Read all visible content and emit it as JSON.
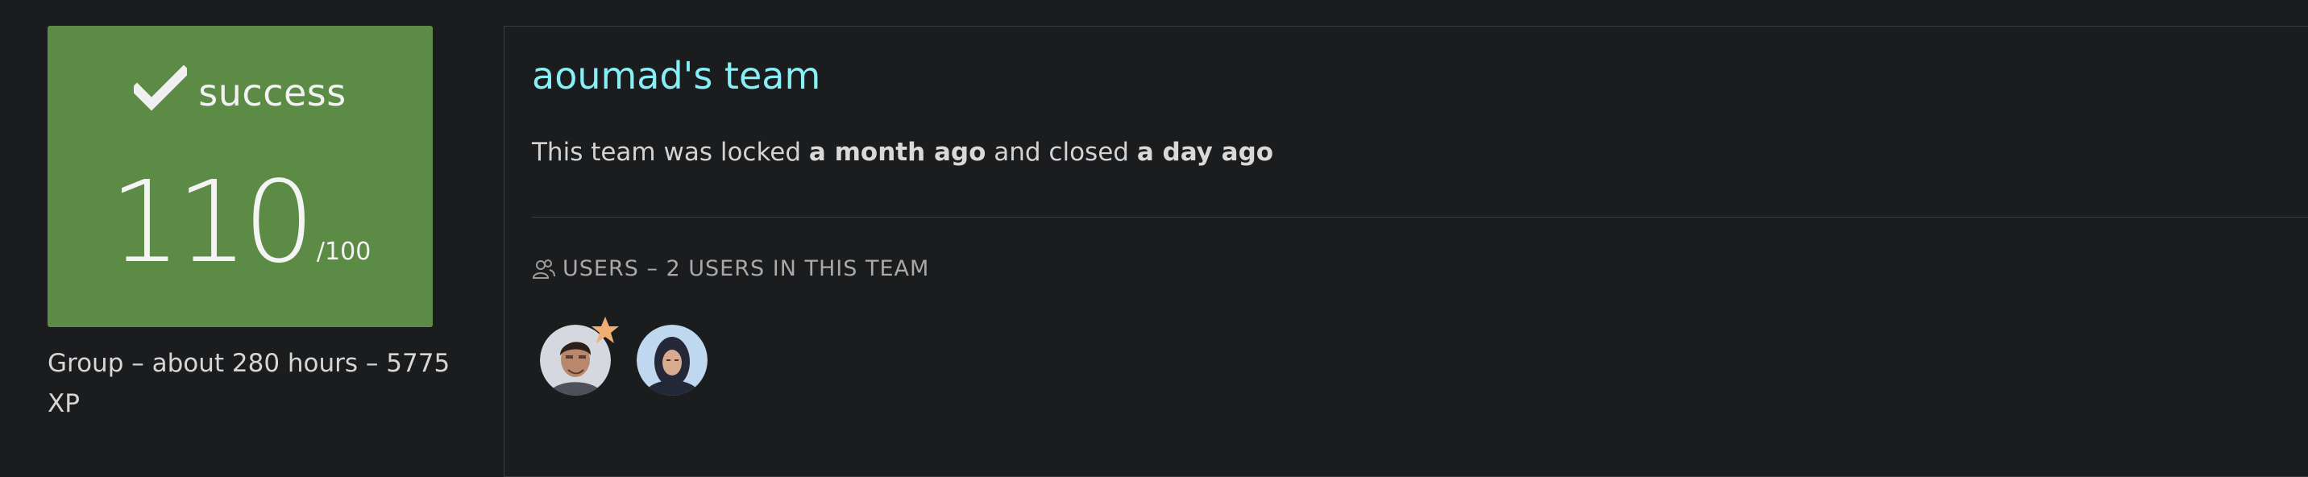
{
  "score_card": {
    "status_icon": "check-icon",
    "status": "success",
    "score": "110",
    "max_score": "/100",
    "background_color": "#5c8b45"
  },
  "group_meta": "Group – about 280 hours – 5775 XP",
  "team": {
    "title": "aoumad's team",
    "status_prefix": "This team was locked",
    "locked_time": "a month ago",
    "status_middle": "and closed",
    "closed_time": "a day ago",
    "title_color": "#86f0f6"
  },
  "users": {
    "icon": "users-icon",
    "header": "USERS – 2 USERS IN THIS TEAM",
    "members": [
      {
        "avatar": "member-avatar",
        "is_leader": true
      },
      {
        "avatar": "member-avatar",
        "is_leader": false
      }
    ]
  }
}
